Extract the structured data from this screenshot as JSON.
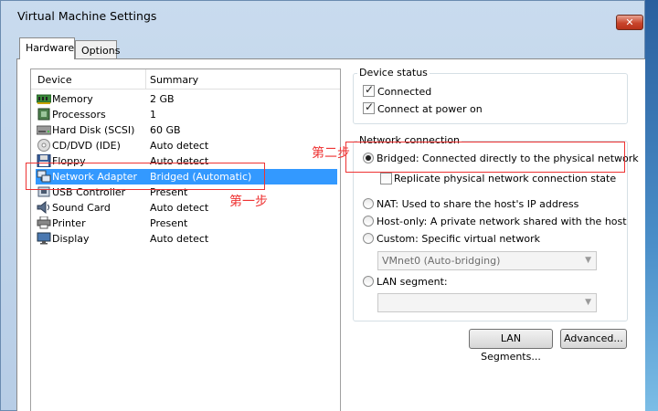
{
  "window": {
    "title": "Virtual Machine Settings",
    "close_glyph": "✕"
  },
  "tabs": [
    {
      "label": "Hardware",
      "active": true
    },
    {
      "label": "Options",
      "active": false
    }
  ],
  "device_list": {
    "columns": [
      "Device",
      "Summary"
    ],
    "rows": [
      {
        "name": "Memory",
        "summary": "2 GB",
        "icon": "memory-icon"
      },
      {
        "name": "Processors",
        "summary": "1",
        "icon": "processor-icon"
      },
      {
        "name": "Hard Disk (SCSI)",
        "summary": "60 GB",
        "icon": "hard-disk-icon"
      },
      {
        "name": "CD/DVD (IDE)",
        "summary": "Auto detect",
        "icon": "cd-dvd-icon"
      },
      {
        "name": "Floppy",
        "summary": "Auto detect",
        "icon": "floppy-icon"
      },
      {
        "name": "Network Adapter",
        "summary": "Bridged (Automatic)",
        "icon": "network-adapter-icon",
        "selected": true
      },
      {
        "name": "USB Controller",
        "summary": "Present",
        "icon": "usb-icon"
      },
      {
        "name": "Sound Card",
        "summary": "Auto detect",
        "icon": "sound-card-icon"
      },
      {
        "name": "Printer",
        "summary": "Present",
        "icon": "printer-icon"
      },
      {
        "name": "Display",
        "summary": "Auto detect",
        "icon": "display-icon"
      }
    ]
  },
  "device_status": {
    "label": "Device status",
    "connected": {
      "label": "Connected",
      "checked": true
    },
    "connect_at_power_on": {
      "label": "Connect at power on",
      "checked": true
    }
  },
  "network_connection": {
    "label": "Network connection",
    "bridged": {
      "label": "Bridged: Connected directly to the physical network",
      "selected": true
    },
    "replicate": {
      "label": "Replicate physical network connection state",
      "checked": false
    },
    "nat": {
      "label": "NAT: Used to share the host's IP address",
      "selected": false
    },
    "host_only": {
      "label": "Host-only: A private network shared with the host",
      "selected": false
    },
    "custom": {
      "label": "Custom: Specific virtual network",
      "selected": false
    },
    "custom_select": {
      "value": "VMnet0 (Auto-bridging)"
    },
    "lan_segment": {
      "label": "LAN segment:",
      "selected": false
    },
    "lan_select": {
      "value": ""
    }
  },
  "buttons": {
    "lan_segments": "LAN Segments...",
    "advanced": "Advanced..."
  },
  "annotations": {
    "step1": "第一步",
    "step2": "第二步",
    "color": "#e33333"
  },
  "colors": {
    "selection": "#3399ff",
    "window_frame": "#b7cde6"
  }
}
